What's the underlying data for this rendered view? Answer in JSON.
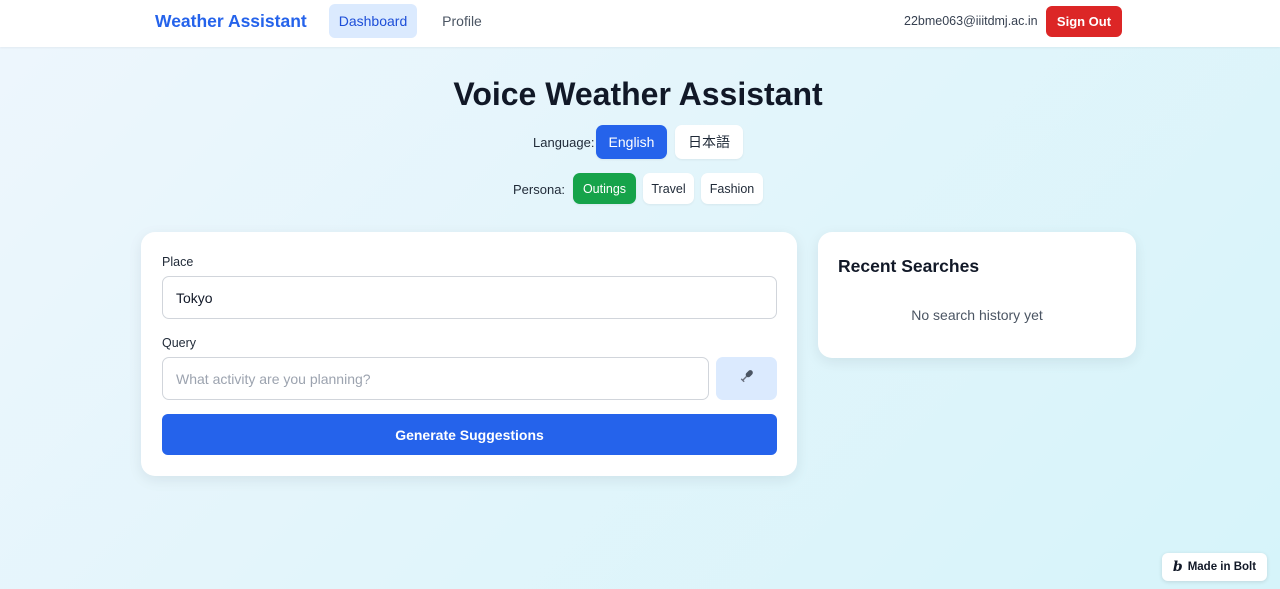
{
  "header": {
    "brand": "Weather Assistant",
    "nav": [
      {
        "label": "Dashboard",
        "active": true
      },
      {
        "label": "Profile",
        "active": false
      }
    ],
    "user_email": "22bme063@iiitdmj.ac.in",
    "sign_out_label": "Sign Out"
  },
  "main": {
    "title": "Voice Weather Assistant",
    "language": {
      "label": "Language:",
      "options": [
        {
          "label": "English",
          "selected": true
        },
        {
          "label": "日本語",
          "selected": false
        }
      ]
    },
    "persona": {
      "label": "Persona:",
      "options": [
        {
          "label": "Outings",
          "selected": true
        },
        {
          "label": "Travel",
          "selected": false
        },
        {
          "label": "Fashion",
          "selected": false
        }
      ]
    },
    "form": {
      "place_label": "Place",
      "place_value": "Tokyo",
      "query_label": "Query",
      "query_placeholder": "What activity are you planning?",
      "mic_icon": "microphone-icon",
      "generate_label": "Generate Suggestions"
    },
    "recent": {
      "title": "Recent Searches",
      "empty_text": "No search history yet"
    }
  },
  "badge": {
    "label": "Made in Bolt",
    "logo_glyph": "b"
  },
  "colors": {
    "primary": "#2563eb",
    "danger": "#dc2626",
    "success": "#16a34a",
    "primary_light": "#dbeafe"
  }
}
